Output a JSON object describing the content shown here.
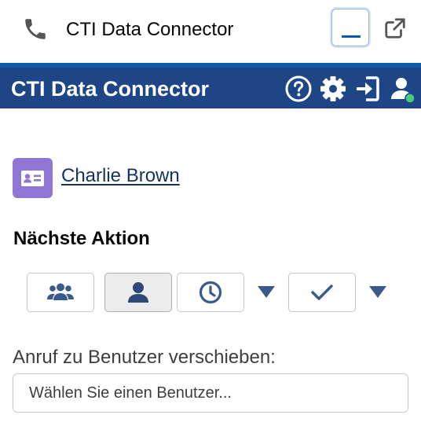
{
  "utility_bar": {
    "title": "CTI Data Connector",
    "icons": {
      "left": "phone-icon",
      "minimize": "minimize-icon",
      "popout": "popout-icon"
    }
  },
  "header": {
    "title": "CTI Data Connector",
    "bg_color": "#1e4687",
    "icons": [
      "help-icon",
      "gear-icon",
      "login-icon",
      "user-status-icon"
    ]
  },
  "contact": {
    "name": "Charlie Brown",
    "badge_icon": "contact-card-icon",
    "badge_color": "#9175d6"
  },
  "next_action": {
    "title": "Nächste Aktion",
    "buttons": [
      {
        "icon": "group-icon",
        "selected": false
      },
      {
        "icon": "person-icon",
        "selected": true
      },
      {
        "icon": "clock-icon",
        "selected": false,
        "has_dropdown": true
      },
      {
        "icon": "check-icon",
        "selected": false,
        "has_dropdown": true
      }
    ]
  },
  "transfer": {
    "label": "Anruf zu Benutzer verschieben:",
    "placeholder": "Wählen Sie einen Benutzer..."
  }
}
